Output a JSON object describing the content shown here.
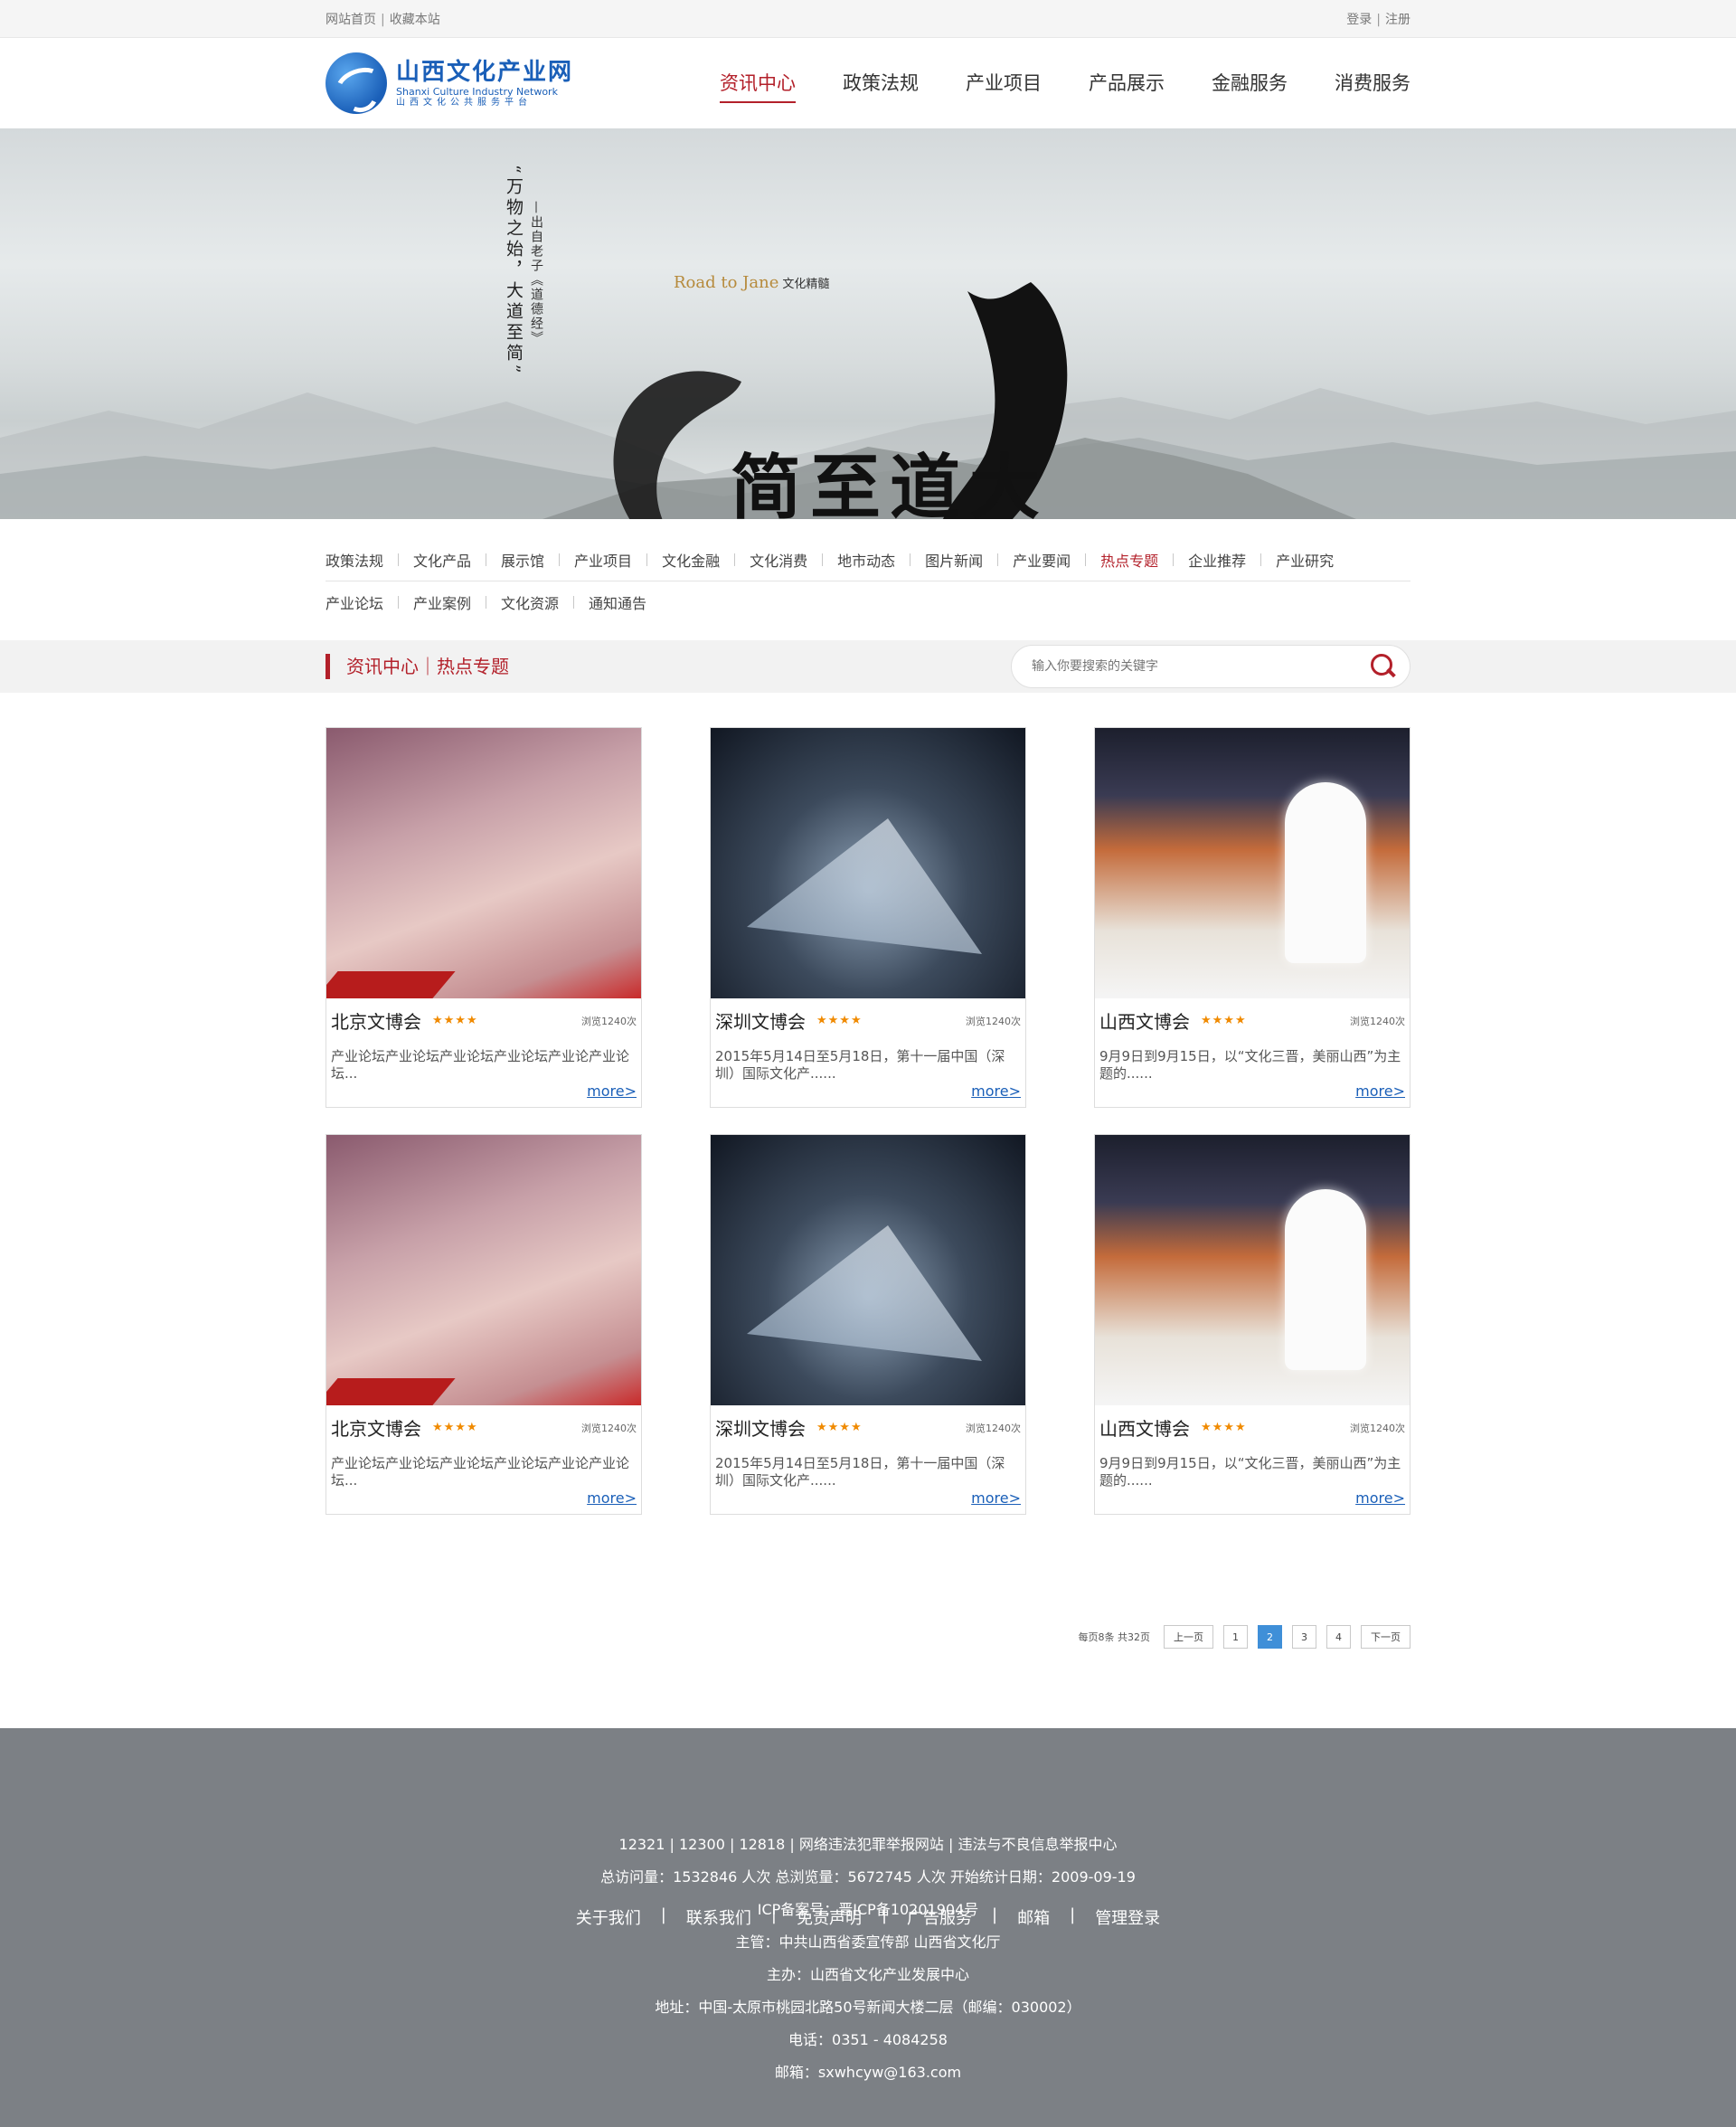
{
  "topbar": {
    "home": "网站首页",
    "favorite": "收藏本站",
    "login": "登录",
    "register": "注册"
  },
  "logo": {
    "cn": "山西文化产业网",
    "en": "Shanxi Culture Industry Network",
    "sub": "山西文化公共服务平台"
  },
  "nav": [
    {
      "label": "资讯中心",
      "active": true
    },
    {
      "label": "政策法规"
    },
    {
      "label": "产业项目"
    },
    {
      "label": "产品展示"
    },
    {
      "label": "金融服务"
    },
    {
      "label": "消费服务"
    }
  ],
  "banner": {
    "quote": "“万物之始，大道至简”",
    "source": "—出自老子《道德经》",
    "road": "Road to Jane",
    "road_cn": "文化精髓",
    "calligraphy": "简至道大"
  },
  "subnav": {
    "row1": [
      "政策法规",
      "文化产品",
      "展示馆",
      "产业项目",
      "文化金融",
      "文化消费",
      "地市动态",
      "图片新闻",
      "产业要闻",
      "热点专题",
      "企业推荐",
      "产业研究"
    ],
    "row2": [
      "产业论坛",
      "产业案例",
      "文化资源",
      "通知通告"
    ],
    "active": "热点专题"
  },
  "crumb": "资讯中心｜热点专题",
  "search": {
    "placeholder": "输入你要搜索的关键字"
  },
  "cards": [
    {
      "title": "北京文博会",
      "stars": "★★★★",
      "views": "浏览1240次",
      "desc": "产业论坛产业论坛产业论坛产业论坛产业论产业论坛...",
      "more": "more>"
    },
    {
      "title": "深圳文博会",
      "stars": "★★★★",
      "views": "浏览1240次",
      "desc": "2015年5月14日至5月18日，第十一届中国（深圳）国际文化产......",
      "more": "more>"
    },
    {
      "title": "山西文博会",
      "stars": "★★★★",
      "views": "浏览1240次",
      "desc": "9月9日到9月15日，以“文化三晋，美丽山西”为主题的......",
      "more": "more>"
    },
    {
      "title": "北京文博会",
      "stars": "★★★★",
      "views": "浏览1240次",
      "desc": "产业论坛产业论坛产业论坛产业论坛产业论产业论坛...",
      "more": "more>"
    },
    {
      "title": "深圳文博会",
      "stars": "★★★★",
      "views": "浏览1240次",
      "desc": "2015年5月14日至5月18日，第十一届中国（深圳）国际文化产......",
      "more": "more>"
    },
    {
      "title": "山西文博会",
      "stars": "★★★★",
      "views": "浏览1240次",
      "desc": "9月9日到9月15日，以“文化三晋，美丽山西”为主题的......",
      "more": "more>"
    }
  ],
  "pager": {
    "info": "每页8条 共32页",
    "prev": "上一页",
    "pages": [
      "1",
      "2",
      "3",
      "4"
    ],
    "current": "2",
    "next": "下一页"
  },
  "footer": {
    "report": "12321 | 12300 | 12818 | 网络违法犯罪举报网站 | 违法与不良信息举报中心",
    "stats": "总访问量：1532846 人次  总浏览量：5672745 人次  开始统计日期：2009-09-19",
    "icp": "ICP备案号：晋ICP备10201904号",
    "links": [
      "关于我们",
      "联系我们",
      "免责声明",
      "广告服务",
      "邮箱",
      "管理登录"
    ],
    "host": "主管：中共山西省委宣传部 山西省文化厅",
    "organizer": "主办：山西省文化产业发展中心",
    "address": "地址：中国-太原市桃园北路50号新闻大楼二层（邮编：030002）",
    "phone": "电话：0351 - 4084258",
    "email": "邮箱：sxwhcyw@163.com"
  }
}
